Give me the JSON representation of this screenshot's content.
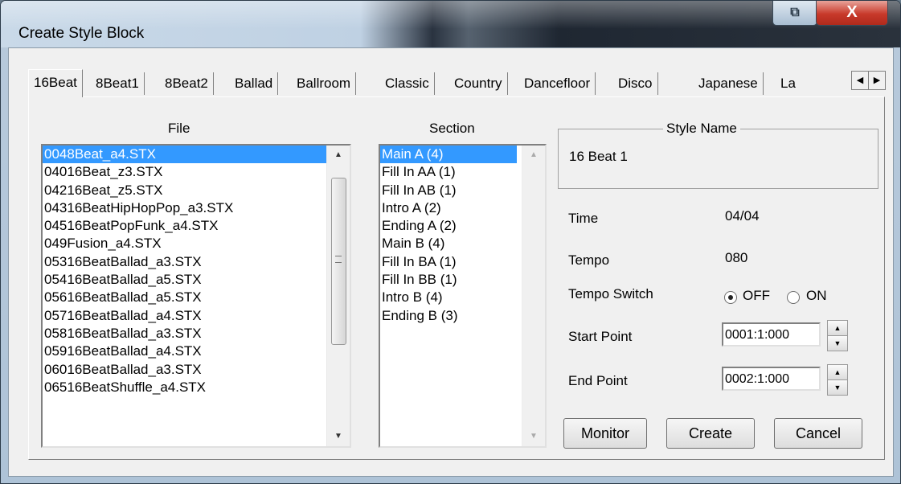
{
  "window": {
    "title": "Create Style Block"
  },
  "tabs": [
    "16Beat",
    "8Beat1",
    "8Beat2",
    "Ballad",
    "Ballroom",
    "Classic",
    "Country",
    "Dancefloor",
    "Disco",
    "Japanese",
    "La"
  ],
  "file": {
    "label": "File",
    "items": [
      "0048Beat_a4.STX",
      "04016Beat_z3.STX",
      "04216Beat_z5.STX",
      "04316BeatHipHopPop_a3.STX",
      "04516BeatPopFunk_a4.STX",
      "049Fusion_a4.STX",
      "05316BeatBallad_a3.STX",
      "05416BeatBallad_a5.STX",
      "05616BeatBallad_a5.STX",
      "05716BeatBallad_a4.STX",
      "05816BeatBallad_a3.STX",
      "05916BeatBallad_a4.STX",
      "06016BeatBallad_a3.STX",
      "06516BeatShuffle_a4.STX"
    ],
    "selected_index": 0
  },
  "section": {
    "label": "Section",
    "items": [
      "Main A (4)",
      "Fill In AA (1)",
      "Fill In AB (1)",
      "Intro A (2)",
      "Ending A (2)",
      "Main B (4)",
      "Fill In BA (1)",
      "Fill In BB (1)",
      "Intro B (4)",
      "Ending B (3)"
    ],
    "selected_index": 0
  },
  "style_name": {
    "label": "Style Name",
    "value": "16 Beat 1"
  },
  "time": {
    "label": "Time",
    "value": "04/04"
  },
  "tempo": {
    "label": "Tempo",
    "value": "080"
  },
  "tempo_switch": {
    "label": "Tempo Switch",
    "off_label": "OFF",
    "on_label": "ON",
    "selected": "OFF"
  },
  "start_point": {
    "label": "Start Point",
    "value": "0001:1:000"
  },
  "end_point": {
    "label": "End Point",
    "value": "0002:1:000"
  },
  "buttons": {
    "monitor": "Monitor",
    "create": "Create",
    "cancel": "Cancel"
  }
}
